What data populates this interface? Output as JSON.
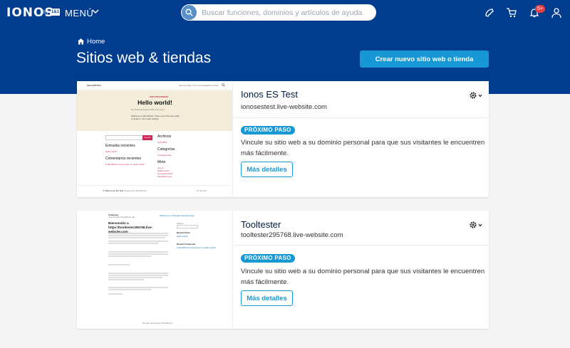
{
  "header": {
    "logo": "IONOS",
    "logo_by": "by",
    "logo_partner": "1&1",
    "menu_label": "MENÚ",
    "search_placeholder": "Buscar funciones, dominios y artículos de ayuda",
    "notification_count": "5+",
    "icons": [
      "phone-icon",
      "cart-icon",
      "bell-icon",
      "user-icon"
    ]
  },
  "hero": {
    "breadcrumb": "Home",
    "title": "Sitios web & tiendas",
    "create_button": "Crear nuevo sitio web o tienda"
  },
  "sites": [
    {
      "name": "Ionos ES Test",
      "domain": "ionosestest.live-website.com",
      "next_step_label": "PRÓXIMO PASO",
      "next_step_text": "Vincule su sitio web a su dominio personal para que sus visitantes le encuentren más fácilmente.",
      "details_button": "Más detalles",
      "preview": {
        "site_title": "Ionos ES Test",
        "nav": "Sample Page    Your Homepage/Entry Page",
        "tag": "UNCATEGORIZED",
        "post_title": "Hello world!",
        "post_meta": "By Tooltesting    April 2021    Comment",
        "post_excerpt": "Welcome to WordPress. This is your first post. Edit or delete it, then start writing!",
        "search_button": "Search",
        "recent_entries": "Entradas recientes",
        "recent_entry": "Hello world!",
        "recent_comments": "Comentarios recientes",
        "recent_comment": "A WordPress Commenter en Hello world!",
        "archives": "Archivos",
        "archive_item": "April 2021",
        "categories": "Categorías",
        "category_item": "Uncategorized",
        "meta": "Meta",
        "meta_items": [
          "Log in",
          "Entries feed",
          "Comments feed",
          "WordPress.org"
        ],
        "footer_left": "© 2021 Ionos ES Test",
        "footer_mid": "Powered by WordPress",
        "footer_right": "To the top ↑"
      }
    },
    {
      "name": "Tooltester",
      "domain": "tooltester295768.live-website.com",
      "next_step_label": "PRÓXIMO PASO",
      "next_step_text": "Vincule su sitio web a su dominio personal para que sus visitantes le encuentren más fácilmente.",
      "details_button": "Más detalles",
      "preview": {
        "site_title": "Tooltester",
        "tagline": "Just another WordPress site",
        "nav": "Welcome to Tooltester    Sample Page",
        "post_title": "Bienvenido a https://tooltester295768.live-website.com",
        "search_label": "Search",
        "recent_posts": "Recent Posts",
        "recent_post": "Hello world!",
        "recent_comments": "Recent Comments",
        "recent_comment": "A WordPress Commenter on Hello world!",
        "footer": "Proudly powered by WordPress"
      }
    }
  ],
  "colors": {
    "brand_navy": "#003d8f",
    "accent_blue": "#1598d3",
    "badge_red": "#e64045",
    "page_bg": "#f4f4f4"
  }
}
